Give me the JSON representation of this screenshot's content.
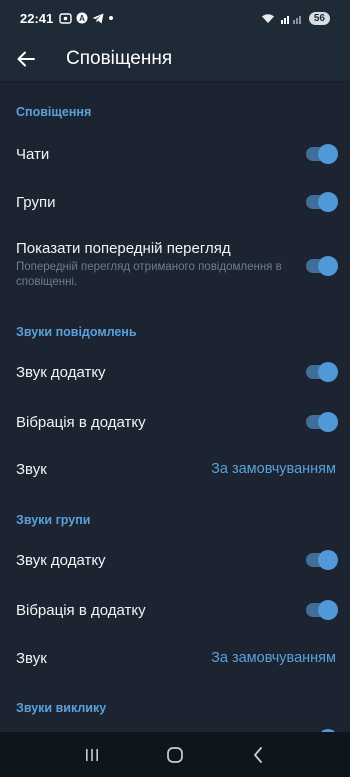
{
  "status_bar": {
    "time": "22:41",
    "battery": "56"
  },
  "app_bar": {
    "title": "Сповіщення"
  },
  "sections": [
    {
      "header": "Сповіщення",
      "rows": [
        {
          "label": "Чати",
          "toggle": true
        },
        {
          "label": "Групи",
          "toggle": true
        },
        {
          "label": "Показати попередній перегляд",
          "sub": "Попередній перегляд отриманого повідомлення в сповіщенні.",
          "toggle": true
        }
      ]
    },
    {
      "header": "Звуки повідомлень",
      "rows": [
        {
          "label": "Звук додатку",
          "toggle": true
        },
        {
          "label": "Вібрація в додатку",
          "toggle": true
        },
        {
          "label": "Звук",
          "value": "За замовчуванням"
        }
      ]
    },
    {
      "header": "Звуки групи",
      "rows": [
        {
          "label": "Звук додатку",
          "toggle": true
        },
        {
          "label": "Вібрація в додатку",
          "toggle": true
        },
        {
          "label": "Звук",
          "value": "За замовчуванням"
        }
      ]
    },
    {
      "header": "Звуки виклику",
      "rows": []
    }
  ],
  "colors": {
    "accent": "#5aa0db",
    "background": "#1b2430",
    "toggle_track": "#3f6f98",
    "toggle_knob": "#5297d6"
  }
}
